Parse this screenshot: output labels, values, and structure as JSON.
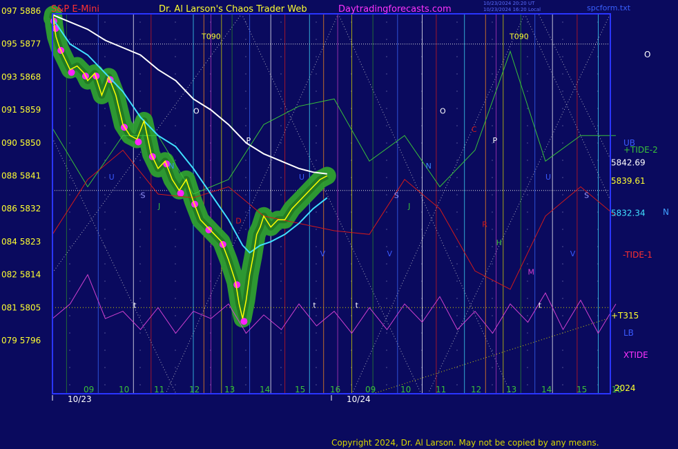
{
  "header": {
    "instrument": "S&P E-Mini",
    "site": "Dr. Al Larson's Chaos Trader Web",
    "url": "Daytradingforecasts.com",
    "time_line1": "10/23/2024 20:20 UT",
    "time_line2": "10/23/2024 16:20 Local",
    "file": "spcform.txt"
  },
  "copyright": "Copyright 2024, Dr. Al Larson. May not be copied by any means.",
  "colors": {
    "background": "#0a0a5e",
    "frame": "#2a35ff",
    "price": "#ffff00",
    "ma_short": "#40e0ff",
    "ma_long": "#ffffff",
    "tide_plus": "#39c13a",
    "tide_minus": "#d21a1a",
    "xtide": "#d040d0",
    "band": "#2fa02f",
    "magenta_dots": "#ff22ff"
  },
  "chart_data": {
    "type": "line",
    "title": "S&P E-Mini",
    "y_left_labels": [
      {
        "code": "097",
        "price": 5886
      },
      {
        "code": "095",
        "price": 5877
      },
      {
        "code": "093",
        "price": 5868
      },
      {
        "code": "091",
        "price": 5859
      },
      {
        "code": "090",
        "price": 5850
      },
      {
        "code": "088",
        "price": 5841
      },
      {
        "code": "086",
        "price": 5832
      },
      {
        "code": "084",
        "price": 5823
      },
      {
        "code": "082",
        "price": 5814
      },
      {
        "code": "081",
        "price": 5805
      },
      {
        "code": "079",
        "price": 5796
      }
    ],
    "ylim": [
      5796,
      5886
    ],
    "x_hour_labels": [
      "09",
      "10",
      "11",
      "12",
      "13",
      "14",
      "15",
      "16",
      "09",
      "10",
      "11",
      "12",
      "13",
      "14",
      "15",
      "16"
    ],
    "x_dates": [
      "10/23",
      "10/24"
    ],
    "year": "2024",
    "price_series": {
      "name": "S&P E-Mini",
      "x": [
        0,
        0.02,
        0.05,
        0.1,
        0.2,
        0.3,
        0.5,
        0.7,
        0.9,
        1.0,
        1.2,
        1.4,
        1.6,
        1.8,
        2.0,
        2.2,
        2.4,
        2.6,
        2.8,
        3.0,
        3.2,
        3.4,
        3.6,
        3.8,
        4.0,
        4.2,
        4.4,
        4.6,
        4.8,
        5.0,
        5.2,
        5.3,
        5.4,
        5.5,
        5.6,
        5.7,
        5.8,
        5.9,
        6.0,
        6.2,
        6.4,
        6.6,
        6.8,
        7.0,
        7.2,
        7.4,
        7.6,
        7.8
      ],
      "y": [
        5884,
        5885,
        5882,
        5879,
        5876,
        5874,
        5870,
        5871,
        5869,
        5867,
        5869,
        5863,
        5868,
        5863,
        5855,
        5852,
        5851,
        5856,
        5847,
        5843,
        5845,
        5840,
        5837,
        5840,
        5834,
        5829,
        5827,
        5825,
        5823,
        5818,
        5812,
        5806,
        5802,
        5807,
        5814,
        5819,
        5825,
        5827,
        5830,
        5827,
        5829,
        5829,
        5832,
        5834,
        5836,
        5838,
        5840,
        5841
      ]
    },
    "ma_short": {
      "x": [
        0,
        0.5,
        1.0,
        1.5,
        2.0,
        2.5,
        3.0,
        3.5,
        4.0,
        4.5,
        5.0,
        5.4,
        5.6,
        5.9,
        6.2,
        6.6,
        7.0,
        7.4,
        7.8
      ],
      "y": [
        5884,
        5877,
        5874,
        5869,
        5864,
        5857,
        5852,
        5849,
        5843,
        5836,
        5829,
        5822,
        5820,
        5822,
        5823,
        5825,
        5828,
        5832,
        5835
      ]
    },
    "ma_long": {
      "x": [
        0,
        0.5,
        1.0,
        1.5,
        2.0,
        2.5,
        3.0,
        3.5,
        4.0,
        4.5,
        5.0,
        5.5,
        6.0,
        6.5,
        7.0,
        7.4,
        7.8
      ],
      "y": [
        5885,
        5883,
        5881,
        5878,
        5876,
        5874,
        5870,
        5867,
        5862,
        5859,
        5855,
        5850,
        5847,
        5845,
        5843,
        5842,
        5841.5
      ]
    },
    "tide_plus": {
      "name": "+TIDE-2",
      "x": [
        0,
        1,
        2,
        3,
        4,
        5,
        6,
        7,
        8,
        9,
        10,
        11,
        12,
        13,
        14,
        15,
        16
      ],
      "y": [
        5854,
        5838,
        5852,
        5852,
        5836,
        5840,
        5855,
        5860,
        5862,
        5845,
        5852,
        5838,
        5848,
        5875,
        5845,
        5852,
        5852
      ]
    },
    "tide_minus": {
      "name": "-TIDE-1",
      "x": [
        0,
        1,
        2,
        3,
        4,
        5,
        6,
        7,
        8,
        9,
        10,
        11,
        12,
        13,
        14,
        15,
        16
      ],
      "y": [
        5825,
        5840,
        5848,
        5836,
        5835,
        5838,
        5830,
        5828,
        5826,
        5825,
        5840,
        5832,
        5815,
        5810,
        5830,
        5838,
        5830
      ]
    },
    "xtide": {
      "name": "XTIDE",
      "x": [
        0,
        0.5,
        1,
        1.5,
        2,
        2.5,
        3,
        3.5,
        4,
        4.5,
        5,
        5.5,
        6,
        6.5,
        7,
        7.5,
        8,
        8.5,
        9,
        9.5,
        10,
        10.5,
        11,
        11.5,
        12,
        12.5,
        13,
        13.5,
        14,
        14.5,
        15,
        15.5,
        16
      ],
      "y": [
        5802,
        5806,
        5814,
        5802,
        5804,
        5799,
        5805,
        5798,
        5804,
        5802,
        5806,
        5798,
        5803,
        5799,
        5806,
        5800,
        5804,
        5798,
        5805,
        5799,
        5806,
        5801,
        5808,
        5799,
        5804,
        5798,
        5806,
        5801,
        5809,
        5799,
        5807,
        5798,
        5806
      ]
    },
    "vertical_line_hours": [
      0.4,
      1.3,
      2.3,
      2.8,
      4.0,
      4.3,
      4.5,
      4.8,
      5.1,
      5.6,
      6.2,
      6.6,
      7.3,
      7.7,
      8.1,
      8.5,
      9.1,
      9.8,
      10.5,
      10.9,
      11.7,
      12.3,
      12.6,
      12.8,
      13.3,
      13.7,
      14.2,
      14.9,
      15.5
    ],
    "level_lines": [
      {
        "label": "T090",
        "price": 5877
      },
      {
        "label": "",
        "price": 5837
      }
    ],
    "price_labels": [
      {
        "text": "5842.69",
        "price": 5842.69
      },
      {
        "text": "5839.61",
        "price": 5839.61
      },
      {
        "text": "5832.34",
        "price": 5832.34
      }
    ],
    "right_labels": [
      "O",
      "UB",
      "+TIDE-2",
      "N",
      "-TIDE-1",
      "+T315",
      "LB",
      "XTIDE"
    ],
    "plot_letters": [
      {
        "t": "O",
        "x": 4.0,
        "y": 5858
      },
      {
        "t": "P",
        "x": 5.5,
        "y": 5850
      },
      {
        "t": "N",
        "x": 3.3,
        "y": 5843
      },
      {
        "t": "U",
        "x": 1.6,
        "y": 5840
      },
      {
        "t": "U",
        "x": 7.0,
        "y": 5840
      },
      {
        "t": "S",
        "x": 2.5,
        "y": 5835
      },
      {
        "t": "J",
        "x": 3.0,
        "y": 5832
      },
      {
        "t": "D",
        "x": 5.2,
        "y": 5828
      },
      {
        "t": "O",
        "x": 11.0,
        "y": 5858
      },
      {
        "t": "C",
        "x": 11.9,
        "y": 5853
      },
      {
        "t": "P",
        "x": 12.5,
        "y": 5850
      },
      {
        "t": "N",
        "x": 10.6,
        "y": 5843
      },
      {
        "t": "S",
        "x": 9.7,
        "y": 5835
      },
      {
        "t": "J",
        "x": 10.1,
        "y": 5832
      },
      {
        "t": "R",
        "x": 12.2,
        "y": 5827
      },
      {
        "t": "H",
        "x": 12.6,
        "y": 5822
      },
      {
        "t": "M",
        "x": 13.5,
        "y": 5814
      },
      {
        "t": "U",
        "x": 14.0,
        "y": 5840
      },
      {
        "t": "S",
        "x": 15.1,
        "y": 5835
      },
      {
        "t": "V",
        "x": 7.6,
        "y": 5819
      },
      {
        "t": "V",
        "x": 9.5,
        "y": 5819
      },
      {
        "t": "V",
        "x": 14.7,
        "y": 5819
      },
      {
        "t": "t",
        "x": 2.3,
        "y": 5805
      },
      {
        "t": "t",
        "x": 7.4,
        "y": 5805
      },
      {
        "t": "t",
        "x": 8.6,
        "y": 5805
      },
      {
        "t": "t",
        "x": 13.8,
        "y": 5805
      }
    ]
  }
}
